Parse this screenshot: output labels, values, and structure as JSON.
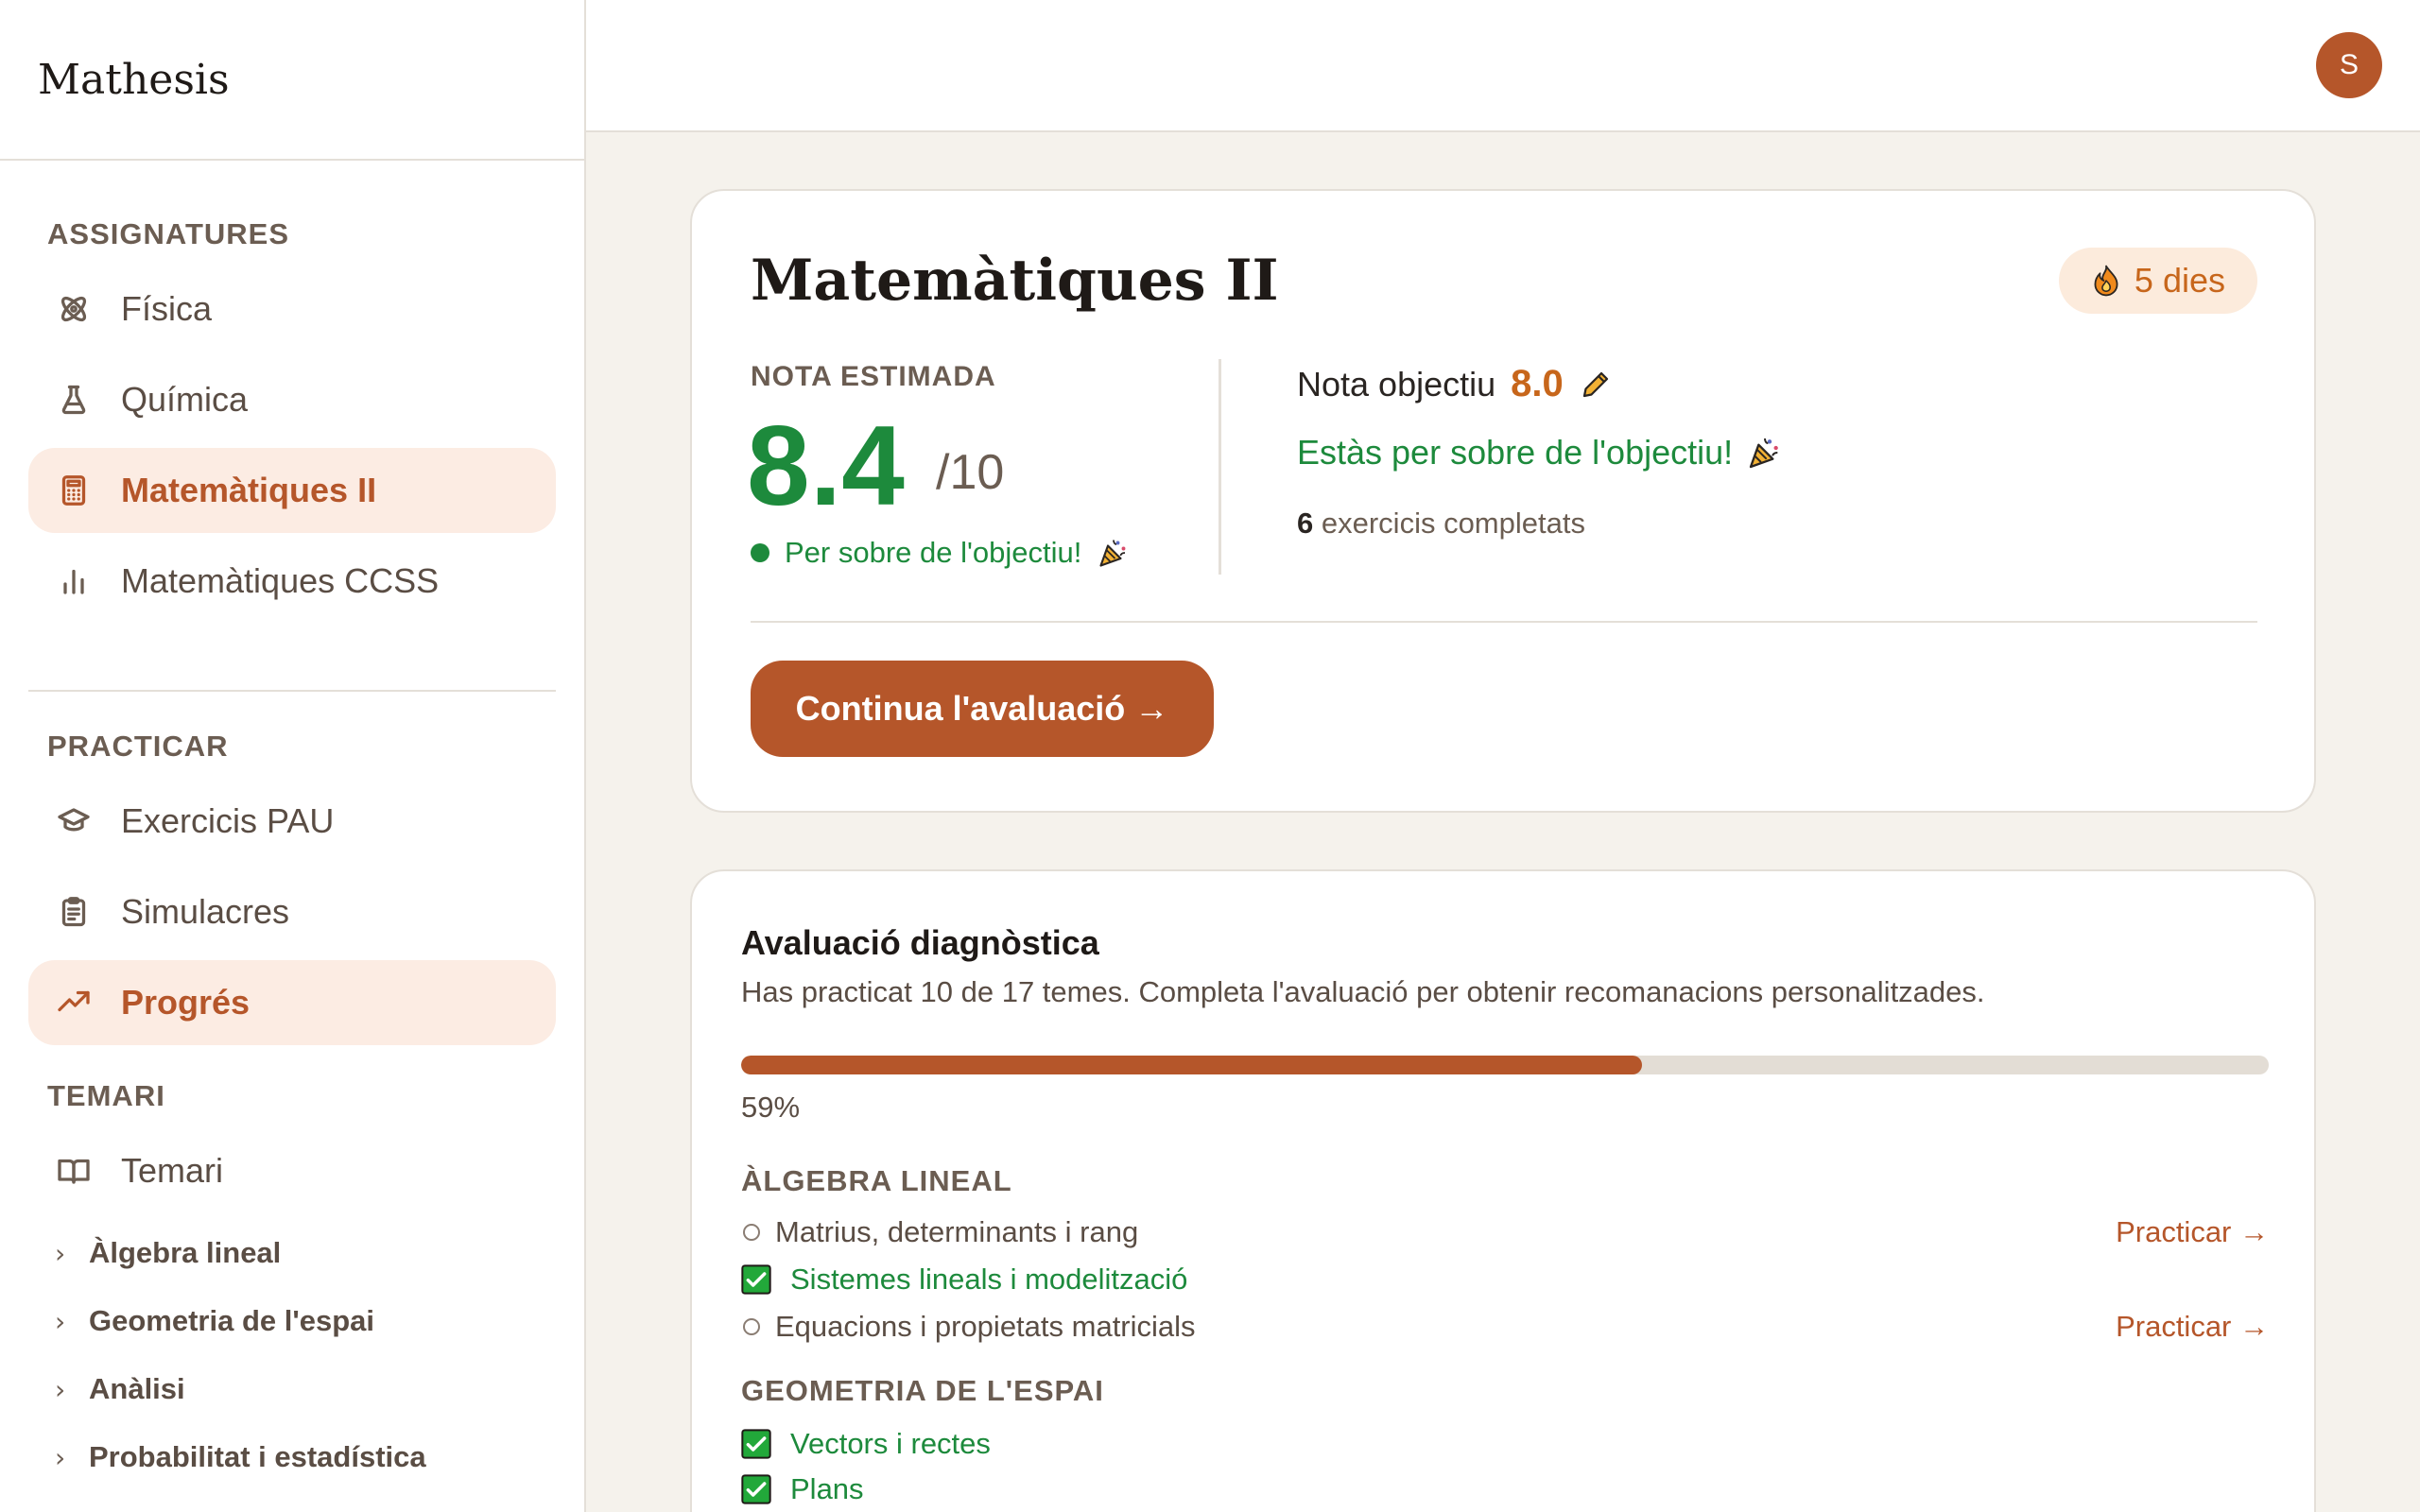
{
  "app": {
    "name": "Mathesis"
  },
  "user": {
    "initial": "S"
  },
  "sidebar": {
    "subjects_heading": "ASSIGNATURES",
    "subjects": [
      {
        "label": "Física",
        "icon": "atom-icon"
      },
      {
        "label": "Química",
        "icon": "flask-icon"
      },
      {
        "label": "Matemàtiques II",
        "icon": "calculator-icon",
        "active": true
      },
      {
        "label": "Matemàtiques CCSS",
        "icon": "bar-chart-icon"
      }
    ],
    "practice_heading": "PRACTICAR",
    "practice": [
      {
        "label": "Exercicis PAU",
        "icon": "graduation-cap-icon"
      },
      {
        "label": "Simulacres",
        "icon": "clipboard-icon"
      },
      {
        "label": "Progrés",
        "icon": "trending-up-icon",
        "active": true
      }
    ],
    "syllabus_heading": "TEMARI",
    "syllabus_root": {
      "label": "Temari",
      "icon": "book-icon"
    },
    "syllabus_items": [
      {
        "label": "Àlgebra lineal"
      },
      {
        "label": "Geometria de l'espai"
      },
      {
        "label": "Anàlisi"
      },
      {
        "label": "Probabilitat i estadística"
      }
    ]
  },
  "overview": {
    "title": "Matemàtiques II",
    "streak": "5 dies",
    "estimated_label": "NOTA ESTIMADA",
    "estimated_value": "8.4",
    "estimated_outof": "/10",
    "estimated_status": "Per sobre de l'objectiu!",
    "goal_label": "Nota objectiu",
    "goal_value": "8.0",
    "goal_status": "Estàs per sobre de l'objectiu!",
    "exercises_count": "6",
    "exercises_label": "exercicis completats",
    "cta": "Continua l'avaluació →"
  },
  "diagnostic": {
    "title": "Avaluació diagnòstica",
    "description": "Has practicat 10 de 17 temes. Completa l'avaluació per obtenir recomanacions personalitzades.",
    "progress": 0.59,
    "progress_label": "59%",
    "practice_label": "Practicar →",
    "groups": [
      {
        "heading": "ÀLGEBRA LINEAL",
        "topics": [
          {
            "label": "Matrius, determinants i rang",
            "done": false
          },
          {
            "label": "Sistemes lineals i modelització",
            "done": true
          },
          {
            "label": "Equacions i propietats matricials",
            "done": false
          }
        ]
      },
      {
        "heading": "GEOMETRIA DE L'ESPAI",
        "topics": [
          {
            "label": "Vectors i rectes",
            "done": true
          },
          {
            "label": "Plans",
            "done": true
          }
        ]
      }
    ]
  },
  "colors": {
    "accent": "#b5562a",
    "success": "#1d8a3c",
    "streak": "#c7661b"
  }
}
